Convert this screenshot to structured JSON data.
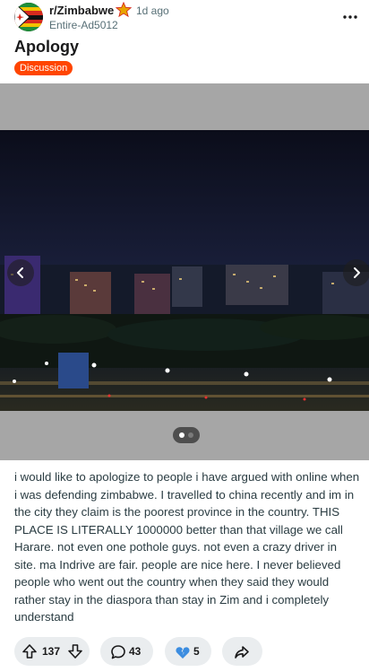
{
  "post": {
    "subreddit": "r/Zimbabwe",
    "time": "1d ago",
    "author": "Entire-Ad5012",
    "title": "Apology",
    "flair": "Discussion",
    "body": "i would like to apologize to people i have argued with online when i was defending zimbabwe. I travelled to china recently and im in the city they claim is the poorest province in the country. THIS PLACE IS LITERALLY 1000000 better than that village we call Harare. not even one pothole guys. not even a crazy driver in site. ma Indrive are fair. people are nice here. I never believed people who went out the country when they said they would rather stay in the diaspora than stay in Zim and i completely understand"
  },
  "media": {
    "current_slide": 1,
    "total_slides": 2
  },
  "actions": {
    "votes": "137",
    "comments": "43",
    "awards": "5"
  },
  "icons": {
    "more": "more-horizontal-icon",
    "upvote": "upvote-arrow-icon",
    "downvote": "downvote-arrow-icon",
    "comment": "comment-bubble-icon",
    "award": "broken-heart-icon",
    "share": "share-arrow-icon",
    "prev": "chevron-left-icon",
    "next": "chevron-right-icon"
  },
  "colors": {
    "flair": "#ff4500",
    "pill": "#eaedef",
    "award_blue": "#3c8de0"
  }
}
